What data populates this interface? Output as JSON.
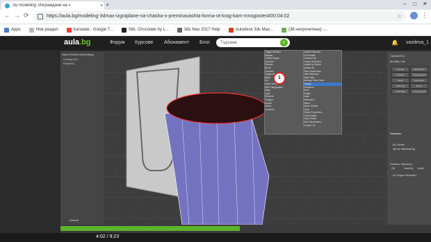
{
  "browser": {
    "tab_title": "3D modeling: Изграждане на ч",
    "tab_close": "×",
    "new_tab": "+",
    "url": "https://aula.bg/modeling-3dmax-izgrajdane-na-chasha-s-preminavashta-forma-ot-krag-kam-mnogosten#00:04:02",
    "bookmarks": [
      {
        "label": "Apps",
        "icon": "apps-icon"
      },
      {
        "label": "Нов раздел",
        "icon": "page-icon"
      },
      {
        "label": "translate - Google T...",
        "icon": "google-icon"
      },
      {
        "label": "Silk, Chocolate by L...",
        "icon": "silk-icon"
      },
      {
        "label": "3ds Max 2017 Help",
        "icon": "autodesk-icon"
      },
      {
        "label": "Autodesk 3ds Max...",
        "icon": "autodesk-icon"
      },
      {
        "label": "(38 непрочетени) -...",
        "icon": "mail-icon"
      }
    ]
  },
  "site": {
    "logo": "aula",
    "logo_suffix": ".bg",
    "nav": [
      "Форум",
      "Курсове",
      "Абонамент",
      "Блог"
    ],
    "search_placeholder": "Търсене",
    "user": "vasileva_1"
  },
  "app": {
    "left_header": "Name (Sorted Ascending)",
    "left_rows": [
      "Cylinder001",
      "Plane001"
    ],
    "right_labels": [
      "Cylinder001",
      "Modifier List",
      "Selection",
      "By Vertex",
      "Ignore Backfacing",
      "Preview Selection",
      "Off",
      "SubObj",
      "Multi",
      "24 Edges Selected"
    ],
    "right_buttons": [
      "Extrude",
      "FFD Select",
      "Chamfer",
      "Turbosmooth",
      "Shell",
      "Cap Holes",
      "Edit Poly",
      "Bevel",
      "UVW Map",
      "Unwrap UVW"
    ],
    "quad_menu": [
      "Isolate Selection",
      "End Isolate",
      "Unfreeze All",
      "Freeze Selection",
      "Unhide by Name",
      "Unhide All",
      "Hide Unselected",
      "Hide Selection",
      "State Sets",
      "Manage State Sets...",
      "Display",
      "Transform",
      "Move",
      "Rotate",
      "Scale",
      "Placement",
      "Select",
      "Select Similar",
      "Clone",
      "Object Properties...",
      "Curve Editor...",
      "Dope Sheet...",
      "Wire Parameters...",
      "Convert To:"
    ],
    "quad_left": [
      "Toggle Shaded",
      "Repeat",
      "Create Shape",
      "Connect",
      "Extrude",
      "Bevel",
      "Chamfer",
      "Target Weld",
      "Weld",
      "Cut",
      "Insert Vertex",
      "Edit Triangulation",
      "Edge",
      "Face",
      "Element",
      "Polygon",
      "Border",
      "Vertex",
      "Top-level"
    ],
    "marker_number": "1",
    "timestamp_label": "Default",
    "video_time": "4:02 / 9:23"
  }
}
